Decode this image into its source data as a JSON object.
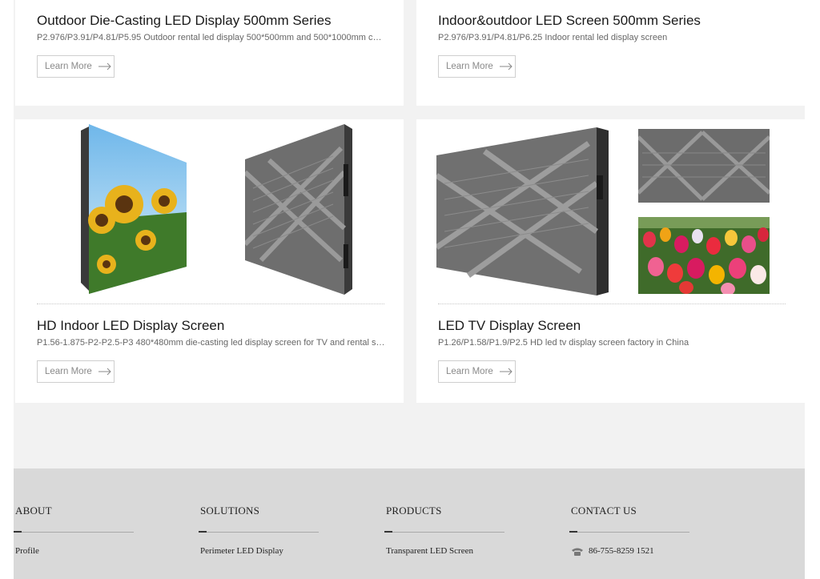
{
  "products": [
    {
      "title": "Outdoor Die-Casting LED Display 500mm Series",
      "desc": "P2.976/P3.91/P4.81/P5.95 Outdoor rental led display 500*500mm and 500*1000mm cabinets",
      "button": "Learn More"
    },
    {
      "title": "Indoor&outdoor LED Screen 500mm Series",
      "desc": "P2.976/P3.91/P4.81/P6.25 Indoor rental led display screen",
      "button": "Learn More"
    },
    {
      "title": "HD Indoor LED Display Screen",
      "desc": "P1.56-1.875-P2-P2.5-P3 480*480mm die-casting led display screen for TV and rental stage",
      "button": "Learn More"
    },
    {
      "title": "LED TV Display Screen",
      "desc": "P1.26/P1.58/P1.9/P2.5 HD led tv display screen factory in China",
      "button": "Learn More"
    }
  ],
  "footer": {
    "columns": [
      {
        "heading": "ABOUT",
        "link": "Profile"
      },
      {
        "heading": "SOLUTIONS",
        "link": "Perimeter LED Display"
      },
      {
        "heading": "PRODUCTS",
        "link": "Transparent LED Screen"
      },
      {
        "heading": "CONTACT US",
        "link": "86-755-8259 1521",
        "icon": "phone-icon"
      }
    ]
  },
  "colors": {
    "card": "#ffffff",
    "background": "#f2f2f2",
    "footer": "#d9d9d9",
    "button_text": "#8a8a8a"
  }
}
